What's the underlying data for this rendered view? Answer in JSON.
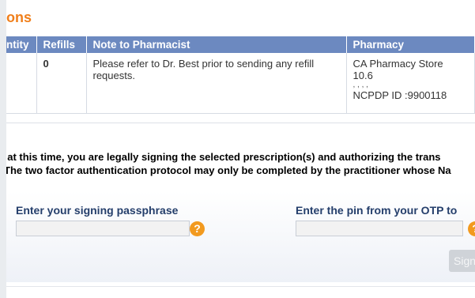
{
  "section": {
    "title_fragment": "ons"
  },
  "table": {
    "headers": {
      "quantity": "ntity",
      "refills": "Refills",
      "note": "Note to Pharmacist",
      "pharmacy": "Pharmacy"
    },
    "row": {
      "refills": "0",
      "note": "Please refer to Dr. Best prior to sending any refill requests.",
      "pharmacy_name": "CA Pharmacy Store",
      "pharmacy_version": "10.6",
      "pharmacy_dots": ", , , ,",
      "pharmacy_ncpdp": "NCPDP ID :9900118"
    }
  },
  "legal": {
    "line1": "l at this time, you are legally signing the selected prescription(s) and authorizing the trans",
    "line2": "The two factor authentication protocol may only be completed by the practitioner whose Na"
  },
  "signing": {
    "passphrase_label": "Enter your signing passphrase",
    "passphrase_value": "",
    "otp_label": "Enter the pin from your OTP to",
    "otp_value": "",
    "help_glyph": "?",
    "sign_button": "Sign"
  },
  "colors": {
    "title_orange": "#f07f1b",
    "header_blue": "#6c89c0",
    "label_navy": "#243e6b",
    "help_orange": "#f29a1f"
  },
  "icons": [
    "help-icon"
  ]
}
